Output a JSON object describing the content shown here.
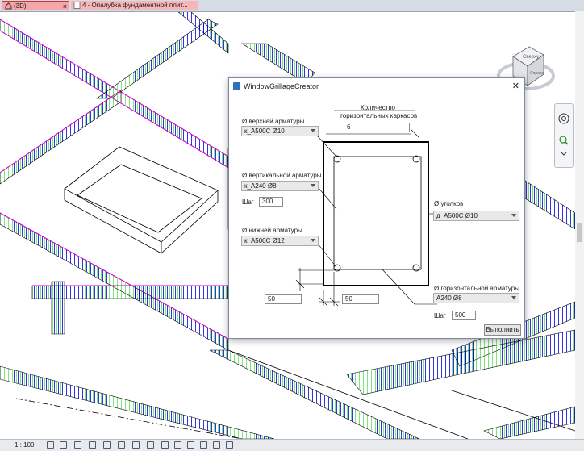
{
  "tabs": [
    {
      "label": "(3D)"
    },
    {
      "label": "4 - Опалубка фундаментной плит..."
    }
  ],
  "status": {
    "scale": "1 : 100"
  },
  "viewcube": {
    "face1": "Сверху",
    "face2": "Справа"
  },
  "dialog": {
    "title": "WindowGrillageCreator",
    "count_label_line1": "Количество",
    "count_label_line2": "горизонтальных каркасов",
    "count_value": "6",
    "top_rebar_label": "Ø верхней арматуры",
    "top_rebar_value": "к_А500С Ø10",
    "vertical_rebar_label": "Ø вертикальной арматуры",
    "vertical_rebar_value": "к_А240 Ø8",
    "step_label": "Шаг",
    "vertical_step_value": "300",
    "bottom_rebar_label": "Ø нижней арматуры",
    "bottom_rebar_value": "к_А500С Ø12",
    "corner_label": "Ø уголков",
    "corner_value": "д_А500С Ø10",
    "horizontal_rebar_label": "Ø горизонтальной арматуры",
    "horizontal_rebar_value": "А240 Ø8",
    "horizontal_step_value": "500",
    "cover_left_value": "50",
    "cover_bottom_value": "50",
    "run_button": "Выполнить"
  },
  "colors": {
    "rebar_green": "#00c800",
    "rebar_blue": "#0000dc",
    "rebar_magenta": "#d000d0",
    "tab_active": "#f6a5a8"
  }
}
